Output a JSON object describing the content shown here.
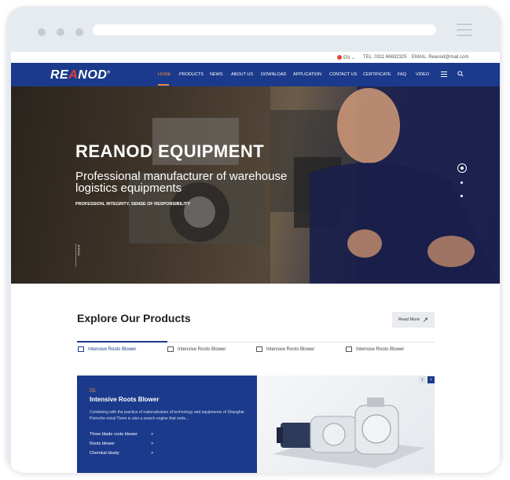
{
  "topbar": {
    "language": "EN",
    "tel": "TEL: 0311 66632325",
    "email": "EMAIL: Reanod@mail.com"
  },
  "brand": {
    "logo_pre": "RE",
    "logo_mid": "A",
    "logo_post": "NOD",
    "reg": "®"
  },
  "nav": {
    "items": [
      {
        "label": "HOME",
        "active": true
      },
      {
        "label": "PRODUCTS"
      },
      {
        "label": "NEWS"
      },
      {
        "label": "ABOUT US"
      },
      {
        "label": "DOWNLOAD"
      },
      {
        "label": "APPLICATION"
      },
      {
        "label": "CONTACT US"
      },
      {
        "label": "CERTIFICATE"
      },
      {
        "label": "FAQ"
      },
      {
        "label": "VIDEO"
      }
    ],
    "accent": "#f08a3b",
    "bar_color": "#1b3a8c"
  },
  "hero": {
    "title": "REANOD EQUIPMENT",
    "subtitle": "Professional manufacturer of warehouse logistics equipments",
    "tagline": "PROFESSION, INTEGRITY, SENSE OF RESPONSIBILITY",
    "side_label": "TOUCH"
  },
  "products": {
    "heading": "Explore Our Products",
    "read_more": "Read More",
    "tabs": [
      {
        "label": "Intensive Roots Blower",
        "active": true
      },
      {
        "label": "Intensive Roots Blower"
      },
      {
        "label": "Intensive Roots Blower"
      },
      {
        "label": "Intensive Roots Blower"
      }
    ],
    "panel": {
      "number": "01",
      "title": "Intensive Roots Blower",
      "description": "Combining with the practice of nationalization of technology and equipments of Shanghai Petroche mical There is also a search engine that sorts...",
      "links": [
        {
          "label": "Three blade roots blower",
          "chevron": ">"
        },
        {
          "label": "Roots blower",
          "chevron": ">"
        },
        {
          "label": "Chemkal idusty",
          "chevron": ">"
        }
      ]
    },
    "pager": {
      "prev": "‹",
      "next": "›"
    }
  }
}
